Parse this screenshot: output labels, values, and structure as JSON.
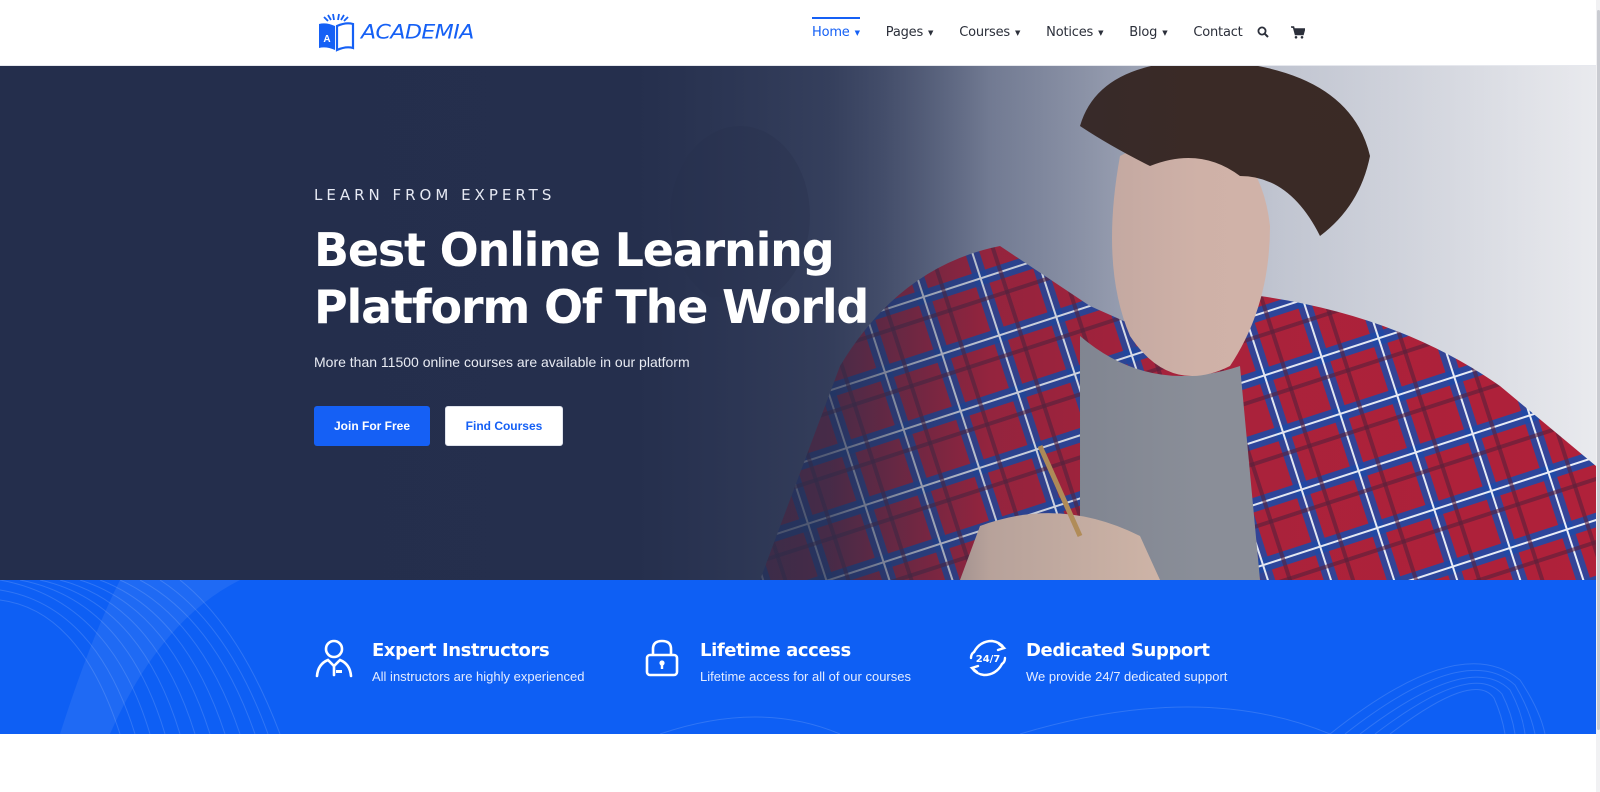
{
  "brand": {
    "name": "Academia",
    "logo_letter": "A",
    "accent_color": "#1560f5"
  },
  "nav": {
    "items": [
      {
        "label": "Home",
        "has_dropdown": true,
        "active": true
      },
      {
        "label": "Pages",
        "has_dropdown": true,
        "active": false
      },
      {
        "label": "Courses",
        "has_dropdown": true,
        "active": false
      },
      {
        "label": "Notices",
        "has_dropdown": true,
        "active": false
      },
      {
        "label": "Blog",
        "has_dropdown": true,
        "active": false
      },
      {
        "label": "Contact",
        "has_dropdown": false,
        "active": false
      }
    ],
    "caret": "▼",
    "icons": [
      "search-icon",
      "cart-icon"
    ]
  },
  "hero": {
    "eyebrow": "LEARN FROM EXPERTS",
    "title_line1": "Best Online Learning",
    "title_line2": "Platform Of The World",
    "subtitle": "More than 11500 online courses are available in our platform",
    "primary_button": "Join For Free",
    "secondary_button": "Find Courses",
    "overlay_color": "#242e4c"
  },
  "features": {
    "background": "#0e5ff4",
    "items": [
      {
        "icon": "instructor-icon",
        "title": "Expert Instructors",
        "description": "All instructors are highly experienced"
      },
      {
        "icon": "lock-icon",
        "title": "Lifetime access",
        "description": "Lifetime access for all of our courses"
      },
      {
        "icon": "support-24-7-icon",
        "title": "Dedicated Support",
        "description": "We provide 24/7 dedicated support",
        "icon_text": "24/7"
      }
    ]
  }
}
